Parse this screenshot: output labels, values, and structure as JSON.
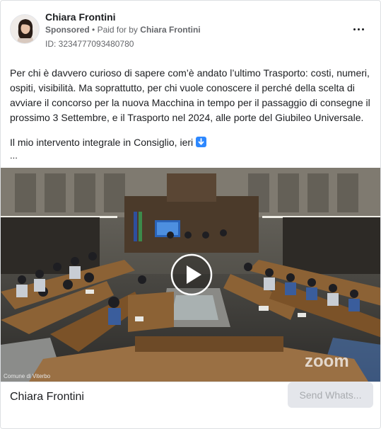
{
  "advertiser": {
    "name": "Chiara Frontini",
    "sponsored_label": "Sponsored",
    "separator": "•",
    "paid_for_prefix": "Paid for by",
    "paid_for_name": "Chiara Frontini",
    "ad_id": "ID: 3234777093480780"
  },
  "post": {
    "paragraph_1": "Per chi è davvero curioso di sapere com’è andato l’ultimo Trasporto: costi, numeri, ospiti, visibilità. Ma soprattutto, per chi vuole conoscere il perché della scelta di avviare il concorso per la nuova Macchina in tempo per il passaggio di consegne il prossimo 3 Settembre, e il Trasporto nel 2024, alle porte del Giubileo Universale.",
    "paragraph_2": "Il mio intervento integrale in Consiglio, ieri",
    "truncated": "..."
  },
  "video": {
    "watermark_left": "Comune di Viterbo",
    "watermark_right": "zoom",
    "play_icon": "play-icon"
  },
  "footer": {
    "page_name": "Chiara Frontini",
    "cta_label": "Send Whats..."
  },
  "icons": {
    "more": "more-horizontal-icon",
    "down_arrow": "down-arrow-emoji-icon"
  },
  "colors": {
    "accent_blue": "#2d88ff",
    "cta_bg": "#e4e6eb",
    "cta_text": "#a8abaf"
  }
}
